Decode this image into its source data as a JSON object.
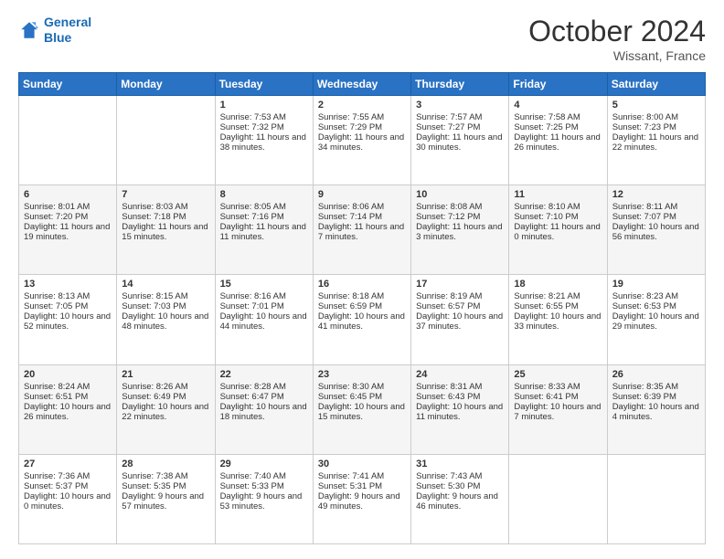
{
  "header": {
    "logo_line1": "General",
    "logo_line2": "Blue",
    "month": "October 2024",
    "location": "Wissant, France"
  },
  "columns": [
    "Sunday",
    "Monday",
    "Tuesday",
    "Wednesday",
    "Thursday",
    "Friday",
    "Saturday"
  ],
  "rows": [
    [
      {
        "day": "",
        "info": ""
      },
      {
        "day": "",
        "info": ""
      },
      {
        "day": "1",
        "info": "Sunrise: 7:53 AM\nSunset: 7:32 PM\nDaylight: 11 hours and 38 minutes."
      },
      {
        "day": "2",
        "info": "Sunrise: 7:55 AM\nSunset: 7:29 PM\nDaylight: 11 hours and 34 minutes."
      },
      {
        "day": "3",
        "info": "Sunrise: 7:57 AM\nSunset: 7:27 PM\nDaylight: 11 hours and 30 minutes."
      },
      {
        "day": "4",
        "info": "Sunrise: 7:58 AM\nSunset: 7:25 PM\nDaylight: 11 hours and 26 minutes."
      },
      {
        "day": "5",
        "info": "Sunrise: 8:00 AM\nSunset: 7:23 PM\nDaylight: 11 hours and 22 minutes."
      }
    ],
    [
      {
        "day": "6",
        "info": "Sunrise: 8:01 AM\nSunset: 7:20 PM\nDaylight: 11 hours and 19 minutes."
      },
      {
        "day": "7",
        "info": "Sunrise: 8:03 AM\nSunset: 7:18 PM\nDaylight: 11 hours and 15 minutes."
      },
      {
        "day": "8",
        "info": "Sunrise: 8:05 AM\nSunset: 7:16 PM\nDaylight: 11 hours and 11 minutes."
      },
      {
        "day": "9",
        "info": "Sunrise: 8:06 AM\nSunset: 7:14 PM\nDaylight: 11 hours and 7 minutes."
      },
      {
        "day": "10",
        "info": "Sunrise: 8:08 AM\nSunset: 7:12 PM\nDaylight: 11 hours and 3 minutes."
      },
      {
        "day": "11",
        "info": "Sunrise: 8:10 AM\nSunset: 7:10 PM\nDaylight: 11 hours and 0 minutes."
      },
      {
        "day": "12",
        "info": "Sunrise: 8:11 AM\nSunset: 7:07 PM\nDaylight: 10 hours and 56 minutes."
      }
    ],
    [
      {
        "day": "13",
        "info": "Sunrise: 8:13 AM\nSunset: 7:05 PM\nDaylight: 10 hours and 52 minutes."
      },
      {
        "day": "14",
        "info": "Sunrise: 8:15 AM\nSunset: 7:03 PM\nDaylight: 10 hours and 48 minutes."
      },
      {
        "day": "15",
        "info": "Sunrise: 8:16 AM\nSunset: 7:01 PM\nDaylight: 10 hours and 44 minutes."
      },
      {
        "day": "16",
        "info": "Sunrise: 8:18 AM\nSunset: 6:59 PM\nDaylight: 10 hours and 41 minutes."
      },
      {
        "day": "17",
        "info": "Sunrise: 8:19 AM\nSunset: 6:57 PM\nDaylight: 10 hours and 37 minutes."
      },
      {
        "day": "18",
        "info": "Sunrise: 8:21 AM\nSunset: 6:55 PM\nDaylight: 10 hours and 33 minutes."
      },
      {
        "day": "19",
        "info": "Sunrise: 8:23 AM\nSunset: 6:53 PM\nDaylight: 10 hours and 29 minutes."
      }
    ],
    [
      {
        "day": "20",
        "info": "Sunrise: 8:24 AM\nSunset: 6:51 PM\nDaylight: 10 hours and 26 minutes."
      },
      {
        "day": "21",
        "info": "Sunrise: 8:26 AM\nSunset: 6:49 PM\nDaylight: 10 hours and 22 minutes."
      },
      {
        "day": "22",
        "info": "Sunrise: 8:28 AM\nSunset: 6:47 PM\nDaylight: 10 hours and 18 minutes."
      },
      {
        "day": "23",
        "info": "Sunrise: 8:30 AM\nSunset: 6:45 PM\nDaylight: 10 hours and 15 minutes."
      },
      {
        "day": "24",
        "info": "Sunrise: 8:31 AM\nSunset: 6:43 PM\nDaylight: 10 hours and 11 minutes."
      },
      {
        "day": "25",
        "info": "Sunrise: 8:33 AM\nSunset: 6:41 PM\nDaylight: 10 hours and 7 minutes."
      },
      {
        "day": "26",
        "info": "Sunrise: 8:35 AM\nSunset: 6:39 PM\nDaylight: 10 hours and 4 minutes."
      }
    ],
    [
      {
        "day": "27",
        "info": "Sunrise: 7:36 AM\nSunset: 5:37 PM\nDaylight: 10 hours and 0 minutes."
      },
      {
        "day": "28",
        "info": "Sunrise: 7:38 AM\nSunset: 5:35 PM\nDaylight: 9 hours and 57 minutes."
      },
      {
        "day": "29",
        "info": "Sunrise: 7:40 AM\nSunset: 5:33 PM\nDaylight: 9 hours and 53 minutes."
      },
      {
        "day": "30",
        "info": "Sunrise: 7:41 AM\nSunset: 5:31 PM\nDaylight: 9 hours and 49 minutes."
      },
      {
        "day": "31",
        "info": "Sunrise: 7:43 AM\nSunset: 5:30 PM\nDaylight: 9 hours and 46 minutes."
      },
      {
        "day": "",
        "info": ""
      },
      {
        "day": "",
        "info": ""
      }
    ]
  ]
}
